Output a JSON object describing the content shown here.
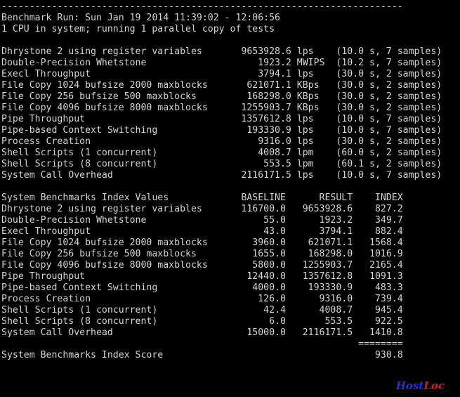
{
  "terminal": {
    "background_color": "#000000",
    "text_color": "#d4d4d4",
    "separator_line": "------------------------------------------------------------------------",
    "header": {
      "run_line": "Benchmark Run: Sun Jan 19 2014 11:39:02 - 12:06:56",
      "cpu_line": "1 CPU in system; running 1 parallel copy of tests"
    },
    "raw_results": {
      "rows": [
        {
          "name": "Dhrystone 2 using register variables",
          "value": "9653928.6",
          "unit": "lps",
          "timing": "(10.0 s, 7 samples)"
        },
        {
          "name": "Double-Precision Whetstone",
          "value": "1923.2",
          "unit": "MWIPS",
          "timing": "(10.2 s, 7 samples)"
        },
        {
          "name": "Execl Throughput",
          "value": "3794.1",
          "unit": "lps",
          "timing": "(30.0 s, 2 samples)"
        },
        {
          "name": "File Copy 1024 bufsize 2000 maxblocks",
          "value": "621071.1",
          "unit": "KBps",
          "timing": "(30.0 s, 2 samples)"
        },
        {
          "name": "File Copy 256 bufsize 500 maxblocks",
          "value": "168298.0",
          "unit": "KBps",
          "timing": "(30.0 s, 2 samples)"
        },
        {
          "name": "File Copy 4096 bufsize 8000 maxblocks",
          "value": "1255903.7",
          "unit": "KBps",
          "timing": "(30.0 s, 2 samples)"
        },
        {
          "name": "Pipe Throughput",
          "value": "1357612.8",
          "unit": "lps",
          "timing": "(10.0 s, 7 samples)"
        },
        {
          "name": "Pipe-based Context Switching",
          "value": "193330.9",
          "unit": "lps",
          "timing": "(10.0 s, 7 samples)"
        },
        {
          "name": "Process Creation",
          "value": "9316.0",
          "unit": "lps",
          "timing": "(30.0 s, 2 samples)"
        },
        {
          "name": "Shell Scripts (1 concurrent)",
          "value": "4008.7",
          "unit": "lpm",
          "timing": "(60.0 s, 2 samples)"
        },
        {
          "name": "Shell Scripts (8 concurrent)",
          "value": "553.5",
          "unit": "lpm",
          "timing": "(60.1 s, 2 samples)"
        },
        {
          "name": "System Call Overhead",
          "value": "2116171.5",
          "unit": "lps",
          "timing": "(10.0 s, 7 samples)"
        }
      ]
    },
    "index_table": {
      "title": "System Benchmarks Index Values",
      "columns": [
        "BASELINE",
        "RESULT",
        "INDEX"
      ],
      "rows": [
        {
          "name": "Dhrystone 2 using register variables",
          "baseline": "116700.0",
          "result": "9653928.6",
          "index": "827.2"
        },
        {
          "name": "Double-Precision Whetstone",
          "baseline": "55.0",
          "result": "1923.2",
          "index": "349.7"
        },
        {
          "name": "Execl Throughput",
          "baseline": "43.0",
          "result": "3794.1",
          "index": "882.4"
        },
        {
          "name": "File Copy 1024 bufsize 2000 maxblocks",
          "baseline": "3960.0",
          "result": "621071.1",
          "index": "1568.4"
        },
        {
          "name": "File Copy 256 bufsize 500 maxblocks",
          "baseline": "1655.0",
          "result": "168298.0",
          "index": "1016.9"
        },
        {
          "name": "File Copy 4096 bufsize 8000 maxblocks",
          "baseline": "5800.0",
          "result": "1255903.7",
          "index": "2165.4"
        },
        {
          "name": "Pipe Throughput",
          "baseline": "12440.0",
          "result": "1357612.8",
          "index": "1091.3"
        },
        {
          "name": "Pipe-based Context Switching",
          "baseline": "4000.0",
          "result": "193330.9",
          "index": "483.3"
        },
        {
          "name": "Process Creation",
          "baseline": "126.0",
          "result": "9316.0",
          "index": "739.4"
        },
        {
          "name": "Shell Scripts (1 concurrent)",
          "baseline": "42.4",
          "result": "4008.7",
          "index": "945.4"
        },
        {
          "name": "Shell Scripts (8 concurrent)",
          "baseline": "6.0",
          "result": "553.5",
          "index": "922.5"
        },
        {
          "name": "System Call Overhead",
          "baseline": "15000.0",
          "result": "2116171.5",
          "index": "1410.8"
        }
      ],
      "score_rule": "========",
      "score_label": "System Benchmarks Index Score",
      "score_value": "930.8"
    }
  },
  "watermark": {
    "part1": "Host",
    "part2": "Loc",
    "part1_color": "#2f2fd0",
    "part2_color": "#cc2020"
  }
}
